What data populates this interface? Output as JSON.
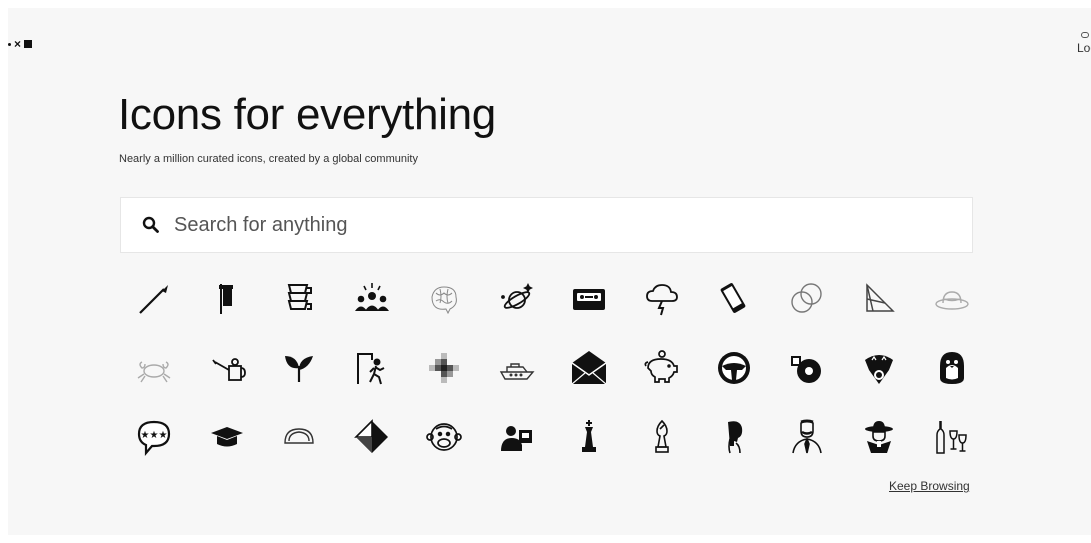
{
  "header": {
    "logo": "logo-mark",
    "login_label": "Log"
  },
  "hero": {
    "title": "Icons for everything",
    "subtitle": "Nearly a million curated icons, created by a global community"
  },
  "search": {
    "placeholder": "Search for anything"
  },
  "icons": [
    "spear-icon",
    "banner-flag-icon",
    "stacked-cups-icon",
    "audience-icon",
    "brain-sketch-icon",
    "planet-orbit-icon",
    "cassette-tape-icon",
    "storm-cloud-icon",
    "smartphone-icon",
    "overlapping-circles-icon",
    "geometric-prism-icon",
    "sun-hat-icon",
    "crab-icon",
    "watering-can-icon",
    "sprout-icon",
    "exit-door-runner-icon",
    "pixel-cross-icon",
    "cruise-ship-icon",
    "envelope-icon",
    "piggy-bank-icon",
    "steering-wheel-icon",
    "turbocharger-icon",
    "flower-bouquet-icon",
    "penguin-icon",
    "chat-rating-icon",
    "graduation-cap-icon",
    "taco-icon",
    "diamond-icon",
    "monkey-face-icon",
    "person-laptop-icon",
    "chess-king-icon",
    "chess-bishop-icon",
    "profile-head-icon",
    "mustache-man-icon",
    "cowboy-icon",
    "wine-glasses-icon"
  ],
  "footer": {
    "keep_browsing": "Keep Browsing"
  }
}
